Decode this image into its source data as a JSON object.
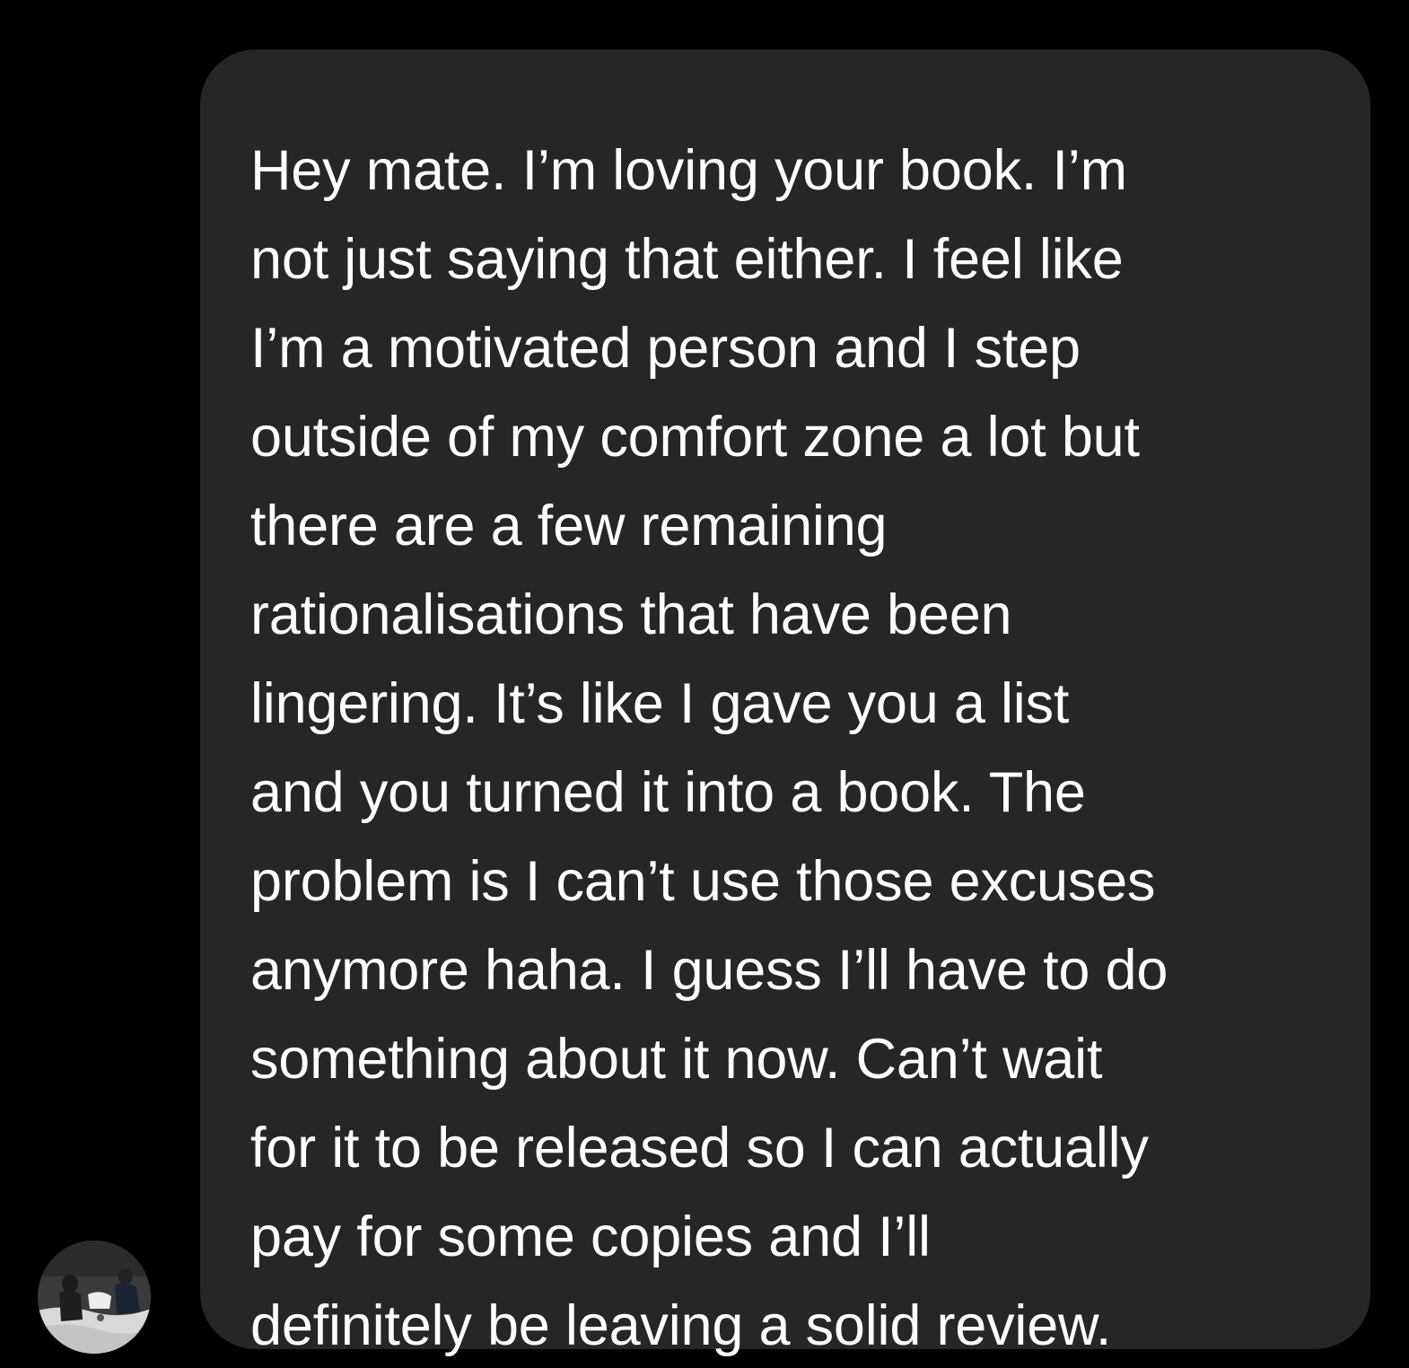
{
  "conversation": {
    "incoming_message": {
      "lines": [
        "Hey mate. I’m loving your book. I’m",
        "not just saying that either. I feel like",
        "I’m a motivated person and I step",
        "outside of my comfort zone a lot but",
        "there are a few remaining",
        "rationalisations that have been",
        "lingering. It’s like I gave you a list",
        "and you turned it into a book. The",
        "problem is I can’t use those excuses",
        "anymore haha. I guess I’ll have to do",
        "something about it now. Can’t wait",
        "for it to be released so I can actually",
        "pay for some copies and I’ll",
        "definitely be leaving a solid review."
      ],
      "sender_avatar_icon": "user-avatar-icon"
    },
    "colors": {
      "background": "#000000",
      "bubble": "#262626",
      "text": "#ffffff"
    }
  }
}
